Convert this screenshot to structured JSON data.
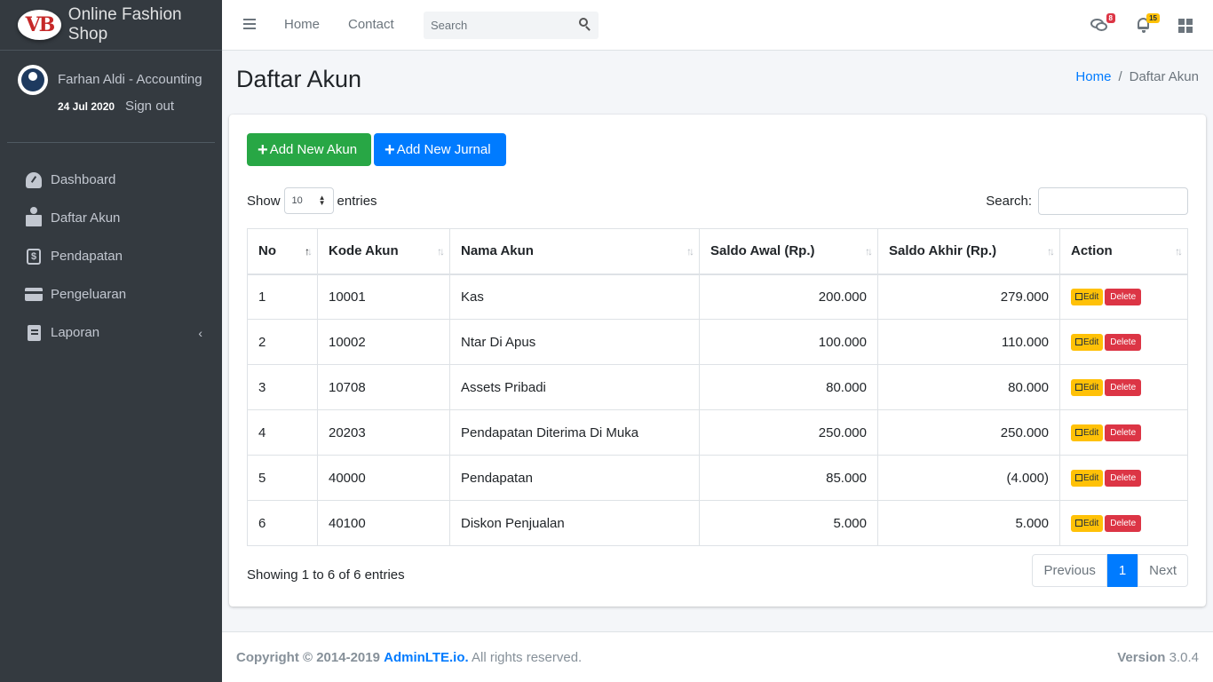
{
  "brand": {
    "logo_text": "VB",
    "name": "Online Fashion Shop"
  },
  "user": {
    "name": "Farhan Aldi - Accounting",
    "date": "24 Jul 2020",
    "sign_out": "Sign out"
  },
  "sidebar": {
    "items": [
      {
        "label": "Dashboard",
        "icon": "tachometer-icon"
      },
      {
        "label": "Daftar Akun",
        "icon": "reader-icon"
      },
      {
        "label": "Pendapatan",
        "icon": "money-icon"
      },
      {
        "label": "Pengeluaran",
        "icon": "credit-card-icon"
      },
      {
        "label": "Laporan",
        "icon": "book-icon",
        "chevron": "‹"
      }
    ]
  },
  "navbar": {
    "links": [
      "Home",
      "Contact"
    ],
    "search_placeholder": "Search",
    "messages_count": "8",
    "notifications_count": "15"
  },
  "page": {
    "title": "Daftar Akun",
    "breadcrumb": {
      "home": "Home",
      "separator": "/",
      "current": "Daftar Akun"
    }
  },
  "actions": {
    "add_akun": "Add New Akun",
    "add_jurnal": "Add New Jurnal"
  },
  "datatable": {
    "show_label": "Show",
    "entries_value": "10",
    "entries_label": "entries",
    "search_label": "Search:",
    "columns": [
      "No",
      "Kode Akun",
      "Nama Akun",
      "Saldo Awal (Rp.)",
      "Saldo Akhir (Rp.)",
      "Action"
    ],
    "rows": [
      {
        "no": "1",
        "kode": "10001",
        "nama": "Kas",
        "saldo_awal": "200.000",
        "saldo_akhir": "279.000"
      },
      {
        "no": "2",
        "kode": "10002",
        "nama": "Ntar Di Apus",
        "saldo_awal": "100.000",
        "saldo_akhir": "110.000"
      },
      {
        "no": "3",
        "kode": "10708",
        "nama": "Assets Pribadi",
        "saldo_awal": "80.000",
        "saldo_akhir": "80.000"
      },
      {
        "no": "4",
        "kode": "20203",
        "nama": "Pendapatan Diterima Di Muka",
        "saldo_awal": "250.000",
        "saldo_akhir": "250.000"
      },
      {
        "no": "5",
        "kode": "40000",
        "nama": "Pendapatan",
        "saldo_awal": "85.000",
        "saldo_akhir": "(4.000)"
      },
      {
        "no": "6",
        "kode": "40100",
        "nama": "Diskon Penjualan",
        "saldo_awal": "5.000",
        "saldo_akhir": "5.000"
      }
    ],
    "edit_label": "Edit",
    "delete_label": "Delete",
    "info": "Showing 1 to 6 of 6 entries",
    "pagination": {
      "previous": "Previous",
      "current": "1",
      "next": "Next"
    }
  },
  "footer": {
    "copyright": "Copyright © 2014-2019",
    "link": "AdminLTE.io.",
    "rights": "All rights reserved.",
    "version_label": "Version",
    "version": "3.0.4"
  },
  "colors": {
    "sidebar_bg": "#343a40",
    "primary": "#007bff",
    "success": "#28a745",
    "warning": "#ffc107",
    "danger": "#dc3545"
  }
}
